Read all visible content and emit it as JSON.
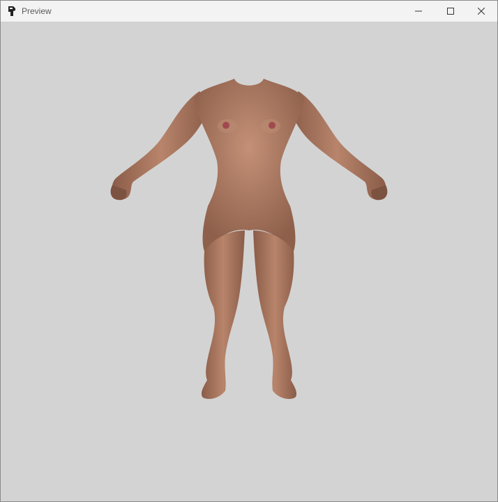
{
  "window": {
    "title": "Preview",
    "controls": {
      "minimize": "minimize-icon",
      "maximize": "maximize-icon",
      "close": "close-icon"
    }
  },
  "viewport": {
    "background": "#d3d3d3",
    "model_skin": "#a8765f"
  }
}
